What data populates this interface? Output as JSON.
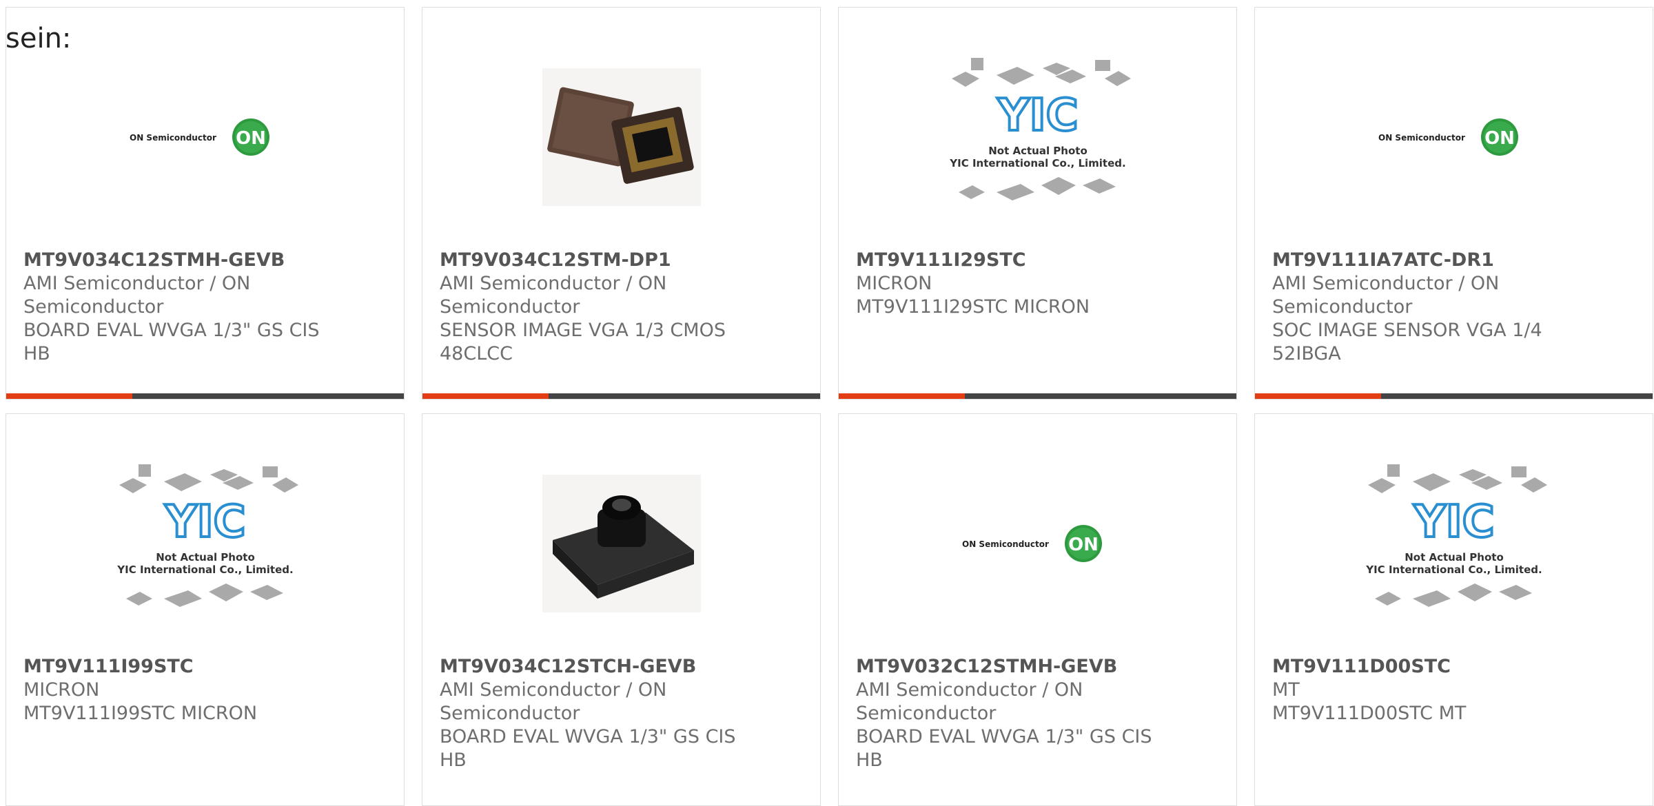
{
  "lead_text": "sein:",
  "colors": {
    "accent": "#e33d16",
    "bar": "#444444",
    "on_green": "#2e9a3f",
    "yic_blue": "#2a8fd0"
  },
  "thumb_text": {
    "on_brand": "ON Semiconductor",
    "on_badge": "ON",
    "yic_logo": "YIC",
    "yic_line1": "Not Actual Photo",
    "yic_line2": "YIC International Co., Limited."
  },
  "cards": [
    {
      "part": "MT9V034C12STMH-GEVB",
      "line1": "AMI Semiconductor / ON Semiconductor",
      "line2": "BOARD EVAL WVGA 1/3\" GS CIS HB",
      "image": "on-semi-logo"
    },
    {
      "part": "MT9V034C12STM-DP1",
      "line1": "AMI Semiconductor / ON Semiconductor",
      "line2": "SENSOR IMAGE VGA 1/3 CMOS 48CLCC",
      "image": "sensor-chip-photo"
    },
    {
      "part": "MT9V111I29STC",
      "line1": "MICRON",
      "line2": "MT9V111I29STC MICRON",
      "image": "yic-placeholder"
    },
    {
      "part": "MT9V111IA7ATC-DR1",
      "line1": "AMI Semiconductor / ON Semiconductor",
      "line2": "SOC IMAGE SENSOR VGA 1/4 52IBGA",
      "image": "on-semi-logo"
    },
    {
      "part": "MT9V111I99STC",
      "line1": "MICRON",
      "line2": "MT9V111I99STC MICRON",
      "image": "yic-placeholder"
    },
    {
      "part": "MT9V034C12STCH-GEVB",
      "line1": "AMI Semiconductor / ON Semiconductor",
      "line2": "BOARD EVAL WVGA 1/3\" GS CIS HB",
      "image": "camera-board-photo"
    },
    {
      "part": "MT9V032C12STMH-GEVB",
      "line1": "AMI Semiconductor / ON Semiconductor",
      "line2": "BOARD EVAL WVGA 1/3\" GS CIS HB",
      "image": "on-semi-logo"
    },
    {
      "part": "MT9V111D00STC",
      "line1": "MT",
      "line2": "MT9V111D00STC MT",
      "image": "yic-placeholder"
    }
  ]
}
